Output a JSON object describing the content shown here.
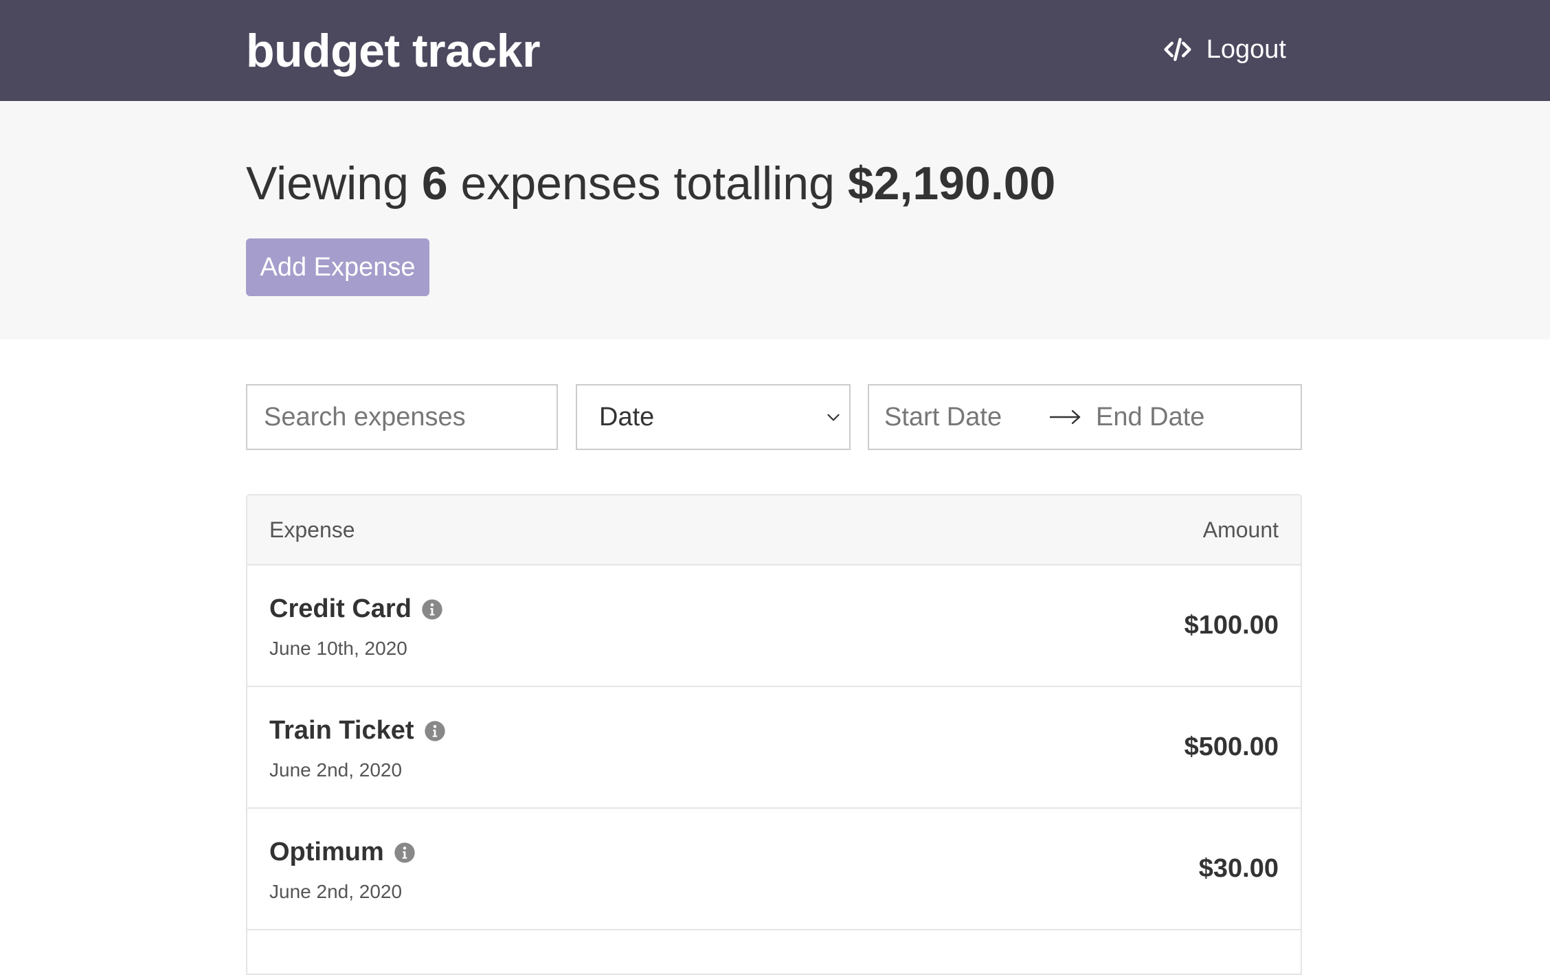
{
  "header": {
    "brand": "budget trackr",
    "logout_label": "Logout"
  },
  "summary": {
    "prefix": "Viewing",
    "count": "6",
    "middle": "expenses totalling",
    "total": "$2,190.00",
    "add_button_label": "Add Expense"
  },
  "filters": {
    "search_placeholder": "Search expenses",
    "sort_selected": "Date",
    "start_date_placeholder": "Start Date",
    "end_date_placeholder": "End Date"
  },
  "list": {
    "columns": [
      "Expense",
      "Amount"
    ],
    "items": [
      {
        "name": "Credit Card",
        "date": "June 10th, 2020",
        "amount": "$100.00"
      },
      {
        "name": "Train Ticket",
        "date": "June 2nd, 2020",
        "amount": "$500.00"
      },
      {
        "name": "Optimum",
        "date": "June 2nd, 2020",
        "amount": "$30.00"
      }
    ]
  },
  "colors": {
    "header_bg": "#4c485e",
    "accent": "#a59dcb",
    "band_bg": "#f7f7f7"
  },
  "icons": {
    "logout": "code-icon",
    "info": "info-icon",
    "select": "chevron-down-icon",
    "range": "arrow-right-icon"
  }
}
